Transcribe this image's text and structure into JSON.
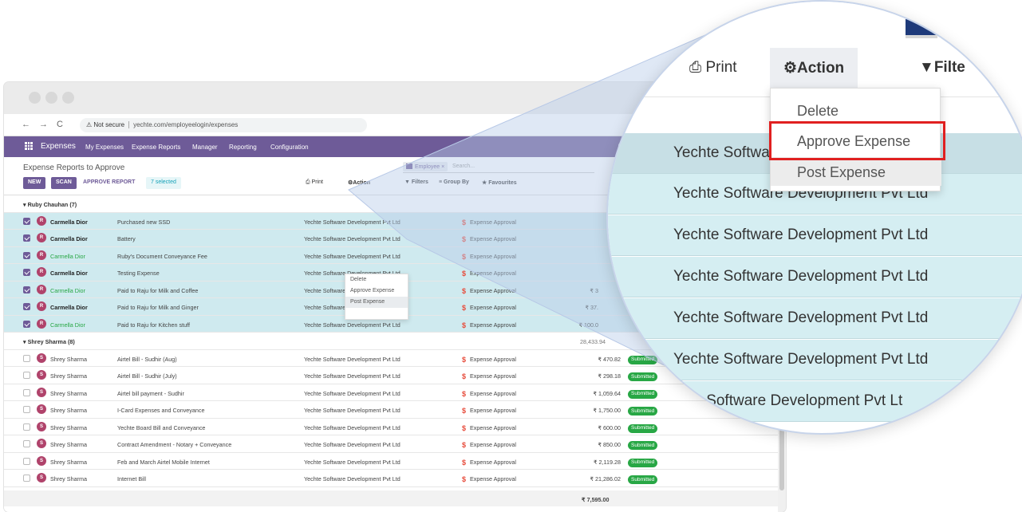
{
  "browser": {
    "security_label": "Not secure",
    "url": "yechte.com/employeelogin/expenses"
  },
  "appnav": {
    "app_title": "Expenses",
    "menus": [
      "My Expenses",
      "Expense Reports",
      "Manager",
      "Reporting",
      "Configuration"
    ]
  },
  "cpanel": {
    "breadcrumb": "Expense Reports to Approve",
    "new_label": "NEW",
    "scan_label": "SCAN",
    "approve_label": "APPROVE REPORT",
    "selected_label": "7 selected",
    "print_label": "Print",
    "action_label": "Action",
    "filters_label": "Filters",
    "groupby_label": "Group By",
    "favourites_label": "Favourites",
    "facet_label": "Employee",
    "search_placeholder": "Search..."
  },
  "action_menu": {
    "items": [
      "Delete",
      "Approve Expense",
      "Post Expense"
    ],
    "highlighted": "Post Expense",
    "boxed": "Approve Expense"
  },
  "groups": [
    {
      "label": "Ruby Chauhan (7)",
      "total": "",
      "rows": [
        {
          "employee": "Carmella Dior",
          "avatar": "R",
          "name_style": "dark",
          "description": "Purchased new SSD",
          "company": "Yechte Software Development Pvt Ltd",
          "status": "Expense Approval",
          "amount": "",
          "state": ""
        },
        {
          "employee": "Carmella Dior",
          "avatar": "R",
          "name_style": "dark",
          "description": "Battery",
          "company": "Yechte Software Development Pvt Ltd",
          "status": "Expense Approval",
          "amount": "",
          "state": ""
        },
        {
          "employee": "Carmella Dior",
          "avatar": "R",
          "name_style": "green",
          "description": "Ruby's Document Conveyance Fee",
          "company": "Yechte Software Development Pvt Ltd",
          "status": "Expense Approval",
          "amount": "",
          "state": ""
        },
        {
          "employee": "Carmella Dior",
          "avatar": "R",
          "name_style": "dark",
          "description": "Testing Expense",
          "company": "Yechte Software Development Pvt Ltd",
          "status": "Expense Approval",
          "amount": "",
          "state": ""
        },
        {
          "employee": "Carmella Dior",
          "avatar": "R",
          "name_style": "green",
          "description": "Paid to Raju for Milk and Coffee",
          "company": "Yechte Software Development Pvt Ltd",
          "status": "Expense Approval",
          "amount": "₹ 3",
          "state": ""
        },
        {
          "employee": "Carmella Dior",
          "avatar": "R",
          "name_style": "dark",
          "description": "Paid to Raju for Milk and Ginger",
          "company": "Yechte Software Development Pvt Ltd",
          "status": "Expense Approval",
          "amount": "₹ 37.",
          "state": ""
        },
        {
          "employee": "Carmella Dior",
          "avatar": "R",
          "name_style": "green",
          "description": "Paid to Raju for Kitchen stuff",
          "company": "Yechte Software Development Pvt Ltd",
          "status": "Expense Approval",
          "amount": "₹ 100.0",
          "state": ""
        }
      ]
    },
    {
      "label": "Shrey Sharma (8)",
      "total": "28,433.94",
      "rows": [
        {
          "employee": "Shrey Sharma",
          "avatar": "S",
          "name_style": "plain",
          "description": "Airtel Bill - Sudhir (Aug)",
          "company": "Yechte Software Development Pvt Ltd",
          "status": "Expense Approval",
          "amount": "₹ 470.82",
          "state": "Submitted"
        },
        {
          "employee": "Shrey Sharma",
          "avatar": "S",
          "name_style": "plain",
          "description": "Airtel Bill - Sudhir (July)",
          "company": "Yechte Software Development Pvt Ltd",
          "status": "Expense Approval",
          "amount": "₹ 298.18",
          "state": "Submitted"
        },
        {
          "employee": "Shrey Sharma",
          "avatar": "S",
          "name_style": "plain",
          "description": "Airtel bill payment - Sudhir",
          "company": "Yechte Software Development Pvt Ltd",
          "status": "Expense Approval",
          "amount": "₹ 1,059.64",
          "state": "Submitted"
        },
        {
          "employee": "Shrey Sharma",
          "avatar": "S",
          "name_style": "plain",
          "description": "I-Card Expenses and Conveyance",
          "company": "Yechte Software Development Pvt Ltd",
          "status": "Expense Approval",
          "amount": "₹ 1,750.00",
          "state": "Submitted"
        },
        {
          "employee": "Shrey Sharma",
          "avatar": "S",
          "name_style": "plain",
          "description": "Yechte Board Bill and Conveyance",
          "company": "Yechte Software Development Pvt Ltd",
          "status": "Expense Approval",
          "amount": "₹ 600.00",
          "state": "Submitted"
        },
        {
          "employee": "Shrey Sharma",
          "avatar": "S",
          "name_style": "plain",
          "description": "Contract Amendment - Notary + Conveyance",
          "company": "Yechte Software Development Pvt Ltd",
          "status": "Expense Approval",
          "amount": "₹ 850.00",
          "state": "Submitted"
        },
        {
          "employee": "Shrey Sharma",
          "avatar": "S",
          "name_style": "plain",
          "description": "Feb and March Airtel Mobile Internet",
          "company": "Yechte Software Development Pvt Ltd",
          "status": "Expense Approval",
          "amount": "₹ 2,119.28",
          "state": "Submitted"
        },
        {
          "employee": "Shrey Sharma",
          "avatar": "S",
          "name_style": "plain",
          "description": "Internet Bill",
          "company": "Yechte Software Development Pvt Ltd",
          "status": "Expense Approval",
          "amount": "₹ 21,286.02",
          "state": "Submitted"
        }
      ]
    }
  ],
  "grand_total": "₹ 7,595.00",
  "magnifier": {
    "print_label": "Print",
    "action_label": "Action",
    "filters_label": "Filte",
    "rows": [
      "Yechte Softwa",
      "Yechte Software Development Pvt Ltd",
      "Yechte Software Development Pvt Ltd",
      "Yechte Software Development Pvt Ltd",
      "Yechte Software Development Pvt Ltd",
      "Yechte Software Development Pvt Ltd",
      "chte Software Development Pvt Lt"
    ]
  },
  "colors": {
    "brand": "#6e5b98",
    "selected_row": "#cfeaef",
    "submitted_badge": "#28a745",
    "highlight_box": "#e02020"
  }
}
